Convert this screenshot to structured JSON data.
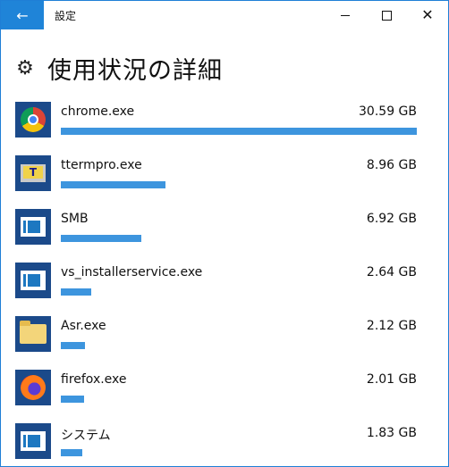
{
  "window": {
    "title": "設定",
    "back_icon": "←",
    "close_icon": "✕"
  },
  "page": {
    "title": "使用状況の詳細",
    "gear_icon": "⚙"
  },
  "colors": {
    "accent": "#1f84d8",
    "bar": "#3d95de",
    "icon_bg": "#1b4a8a"
  },
  "apps": [
    {
      "name": "chrome.exe",
      "size": "30.59 GB",
      "icon": "chrome-icon",
      "share": 1.0
    },
    {
      "name": "ttermpro.exe",
      "size": "8.96 GB",
      "icon": "teraterm-icon",
      "share": 0.293
    },
    {
      "name": "SMB",
      "size": "6.92 GB",
      "icon": "window-app-icon",
      "share": 0.226
    },
    {
      "name": "vs_installerservice.exe",
      "size": "2.64 GB",
      "icon": "window-app-icon",
      "share": 0.086
    },
    {
      "name": "Asr.exe",
      "size": "2.12 GB",
      "icon": "folder-icon",
      "share": 0.069
    },
    {
      "name": "firefox.exe",
      "size": "2.01 GB",
      "icon": "firefox-icon",
      "share": 0.066
    },
    {
      "name": "システム",
      "size": "1.83 GB",
      "icon": "window-app-icon",
      "share": 0.06
    }
  ]
}
